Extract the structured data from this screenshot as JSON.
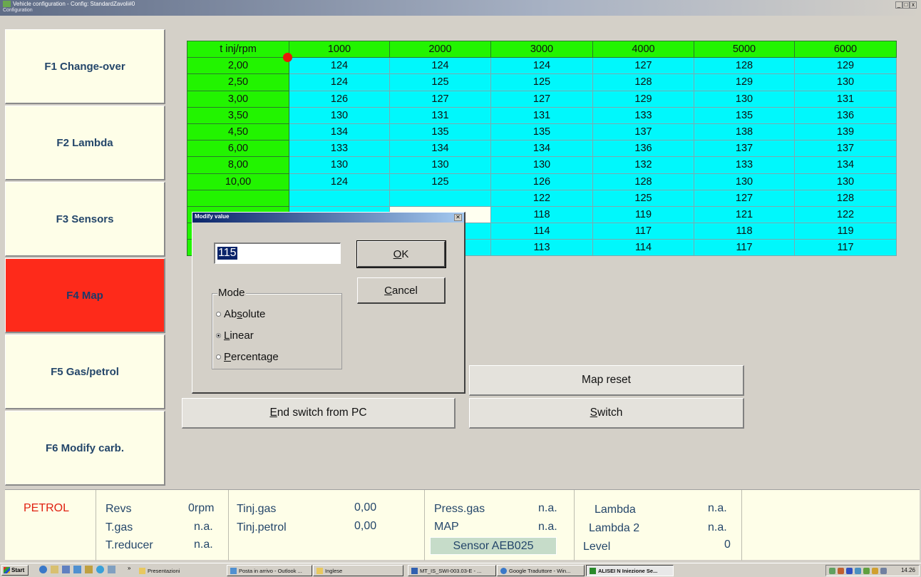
{
  "window": {
    "title": "Vehicle configuration - Config: StandardZavoli#0",
    "menu": "Configuration",
    "controls": [
      "_",
      "□",
      "x"
    ]
  },
  "sidebar": {
    "items": [
      {
        "label": "F1 Change-over"
      },
      {
        "label": "F2 Lambda"
      },
      {
        "label": "F3 Sensors"
      },
      {
        "label": "F4 Map",
        "active": true
      },
      {
        "label": "F5 Gas/petrol"
      },
      {
        "label": "F6 Modify carb."
      }
    ]
  },
  "map": {
    "corner": "t inj/rpm",
    "columns": [
      "1000",
      "2000",
      "3000",
      "4000",
      "5000",
      "6000"
    ],
    "rows": [
      {
        "key": "2,00",
        "cells": [
          "124",
          "124",
          "124",
          "127",
          "128",
          "129"
        ]
      },
      {
        "key": "2,50",
        "cells": [
          "124",
          "125",
          "125",
          "128",
          "129",
          "130"
        ]
      },
      {
        "key": "3,00",
        "cells": [
          "126",
          "127",
          "127",
          "129",
          "130",
          "131"
        ]
      },
      {
        "key": "3,50",
        "cells": [
          "130",
          "131",
          "131",
          "133",
          "135",
          "136"
        ]
      },
      {
        "key": "4,50",
        "cells": [
          "134",
          "135",
          "135",
          "137",
          "138",
          "139"
        ]
      },
      {
        "key": "6,00",
        "cells": [
          "133",
          "134",
          "134",
          "136",
          "137",
          "137"
        ]
      },
      {
        "key": "8,00",
        "cells": [
          "130",
          "130",
          "130",
          "132",
          "133",
          "134"
        ]
      },
      {
        "key": "10,00",
        "cells": [
          "124",
          "125",
          "126",
          "128",
          "130",
          "130"
        ]
      },
      {
        "key": "",
        "cells": [
          "",
          "",
          "122",
          "125",
          "127",
          "128"
        ]
      },
      {
        "key": "",
        "cells": [
          "",
          "",
          "118",
          "119",
          "121",
          "122"
        ]
      },
      {
        "key": "",
        "cells": [
          "",
          "",
          "114",
          "117",
          "118",
          "119"
        ]
      },
      {
        "key": "",
        "cells": [
          "",
          "",
          "113",
          "114",
          "117",
          "117"
        ]
      }
    ]
  },
  "buttons": {
    "map_reset": "Map reset",
    "end_switch": "End switch from PC",
    "end_switch_mnemonic": "E",
    "end_switch_rest": "nd switch from PC",
    "switch": "Switch",
    "switch_mnemonic": "S",
    "switch_rest": "witch"
  },
  "dialog": {
    "title": "Modify value",
    "value": "115",
    "ok_label": "OK",
    "ok_mnemonic": "O",
    "ok_rest": "K",
    "cancel_label": "Cancel",
    "cancel_mnemonic": "C",
    "cancel_rest": "ancel",
    "mode_label": "Mode",
    "modes": [
      {
        "label": "Absolute",
        "pre": "Ab",
        "mnemonic": "s",
        "post": "olute",
        "selected": false
      },
      {
        "label": "Linear",
        "pre": "",
        "mnemonic": "L",
        "post": "inear",
        "selected": true
      },
      {
        "label": "Percentage",
        "pre": "",
        "mnemonic": "P",
        "post": "ercentage",
        "selected": false
      }
    ]
  },
  "status": {
    "fuel": "PETROL",
    "revs_label": "Revs",
    "revs_value": "0rpm",
    "tgas_label": "T.gas",
    "tgas_value": "n.a.",
    "treducer_label": "T.reducer",
    "treducer_value": "n.a.",
    "tinj_gas_label": "Tinj.gas",
    "tinj_gas_value": "0,00",
    "tinj_petrol_label": "Tinj.petrol",
    "tinj_petrol_value": "0,00",
    "press_gas_label": "Press.gas",
    "press_gas_value": "n.a.",
    "map_label": "MAP",
    "map_value": "n.a.",
    "sensor": "Sensor AEB025",
    "lambda_label": "Lambda",
    "lambda_value": "n.a.",
    "lambda2_label": "Lambda 2",
    "lambda2_value": "n.a.",
    "level_label": "Level",
    "level_value": "0"
  },
  "taskbar": {
    "start": "Start",
    "chevron": "»",
    "items": [
      "Presentazioni",
      "Posta in arrivo - Outlook ...",
      "Inglese",
      "MT_IS_SWI-003.03-E - ...",
      "Google Traduttore - Win...",
      "ALISEI N Iniezione Se..."
    ],
    "clock": "14.26"
  },
  "colors": {
    "header_green": "#22f400",
    "cell_cyan": "#00f8fc",
    "active_red": "#fe2a1a",
    "panel_cream": "#fefee8",
    "text_blue": "#24466a"
  }
}
